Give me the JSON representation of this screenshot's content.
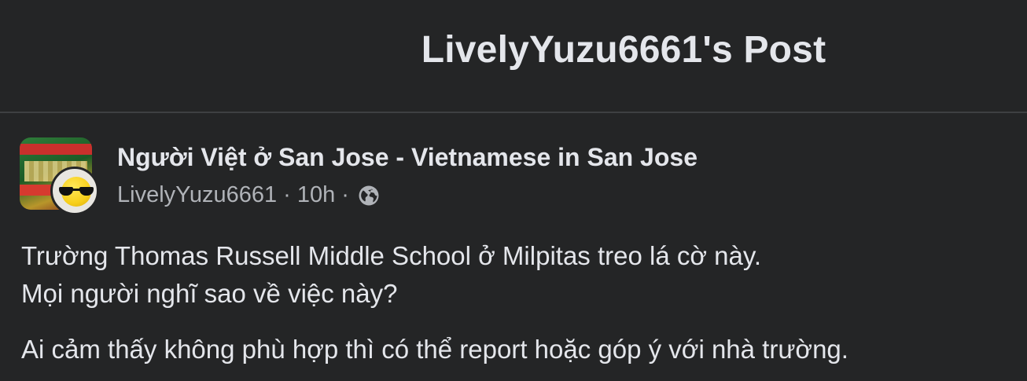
{
  "header": {
    "title": "LivelyYuzu6661's Post"
  },
  "post": {
    "group_name": "Người Việt ở San Jose - Vietnamese in San Jose",
    "author": "LivelyYuzu6661",
    "separator": "·",
    "time": "10h",
    "privacy_icon": "globe-icon",
    "body": {
      "line1": "Trường Thomas Russell Middle School ở Milpitas treo lá cờ này.",
      "line2": "Mọi người nghĩ sao về việc này?",
      "line3": "Ai cảm thấy không phù hợp thì có thể report hoặc góp ý với nhà trường."
    }
  },
  "colors": {
    "background": "#242526",
    "primary_text": "#e4e6eb",
    "secondary_text": "#b0b3b8",
    "divider": "#3e4042"
  }
}
